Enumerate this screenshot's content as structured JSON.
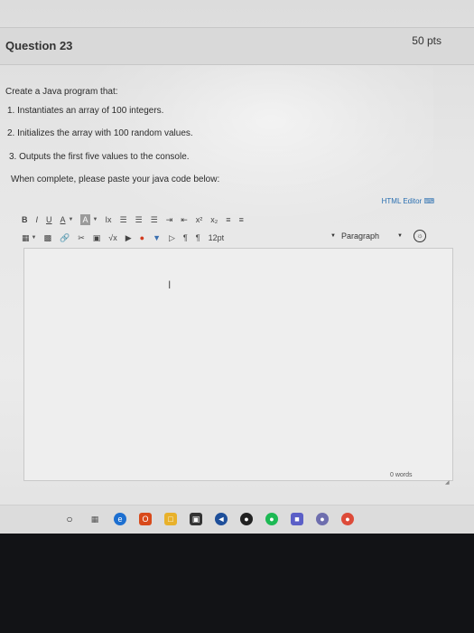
{
  "question": {
    "title": "Question 23",
    "points": "50 pts"
  },
  "prompt": {
    "intro": "Create a Java program that:",
    "steps": [
      "1. Instantiates an array of 100 integers.",
      "2. Initializes the array with 100 random values.",
      "3. Outputs the first five values to the console."
    ],
    "instruction": "When complete, please paste your java code below:"
  },
  "editor": {
    "html_editor_label": "HTML Editor",
    "toolbar_row1": [
      "B",
      "I",
      "U",
      "A",
      "A",
      "Ix",
      "x²",
      "x₂"
    ],
    "font_size": "12pt",
    "block_format": "Paragraph",
    "word_count": "0 words"
  }
}
